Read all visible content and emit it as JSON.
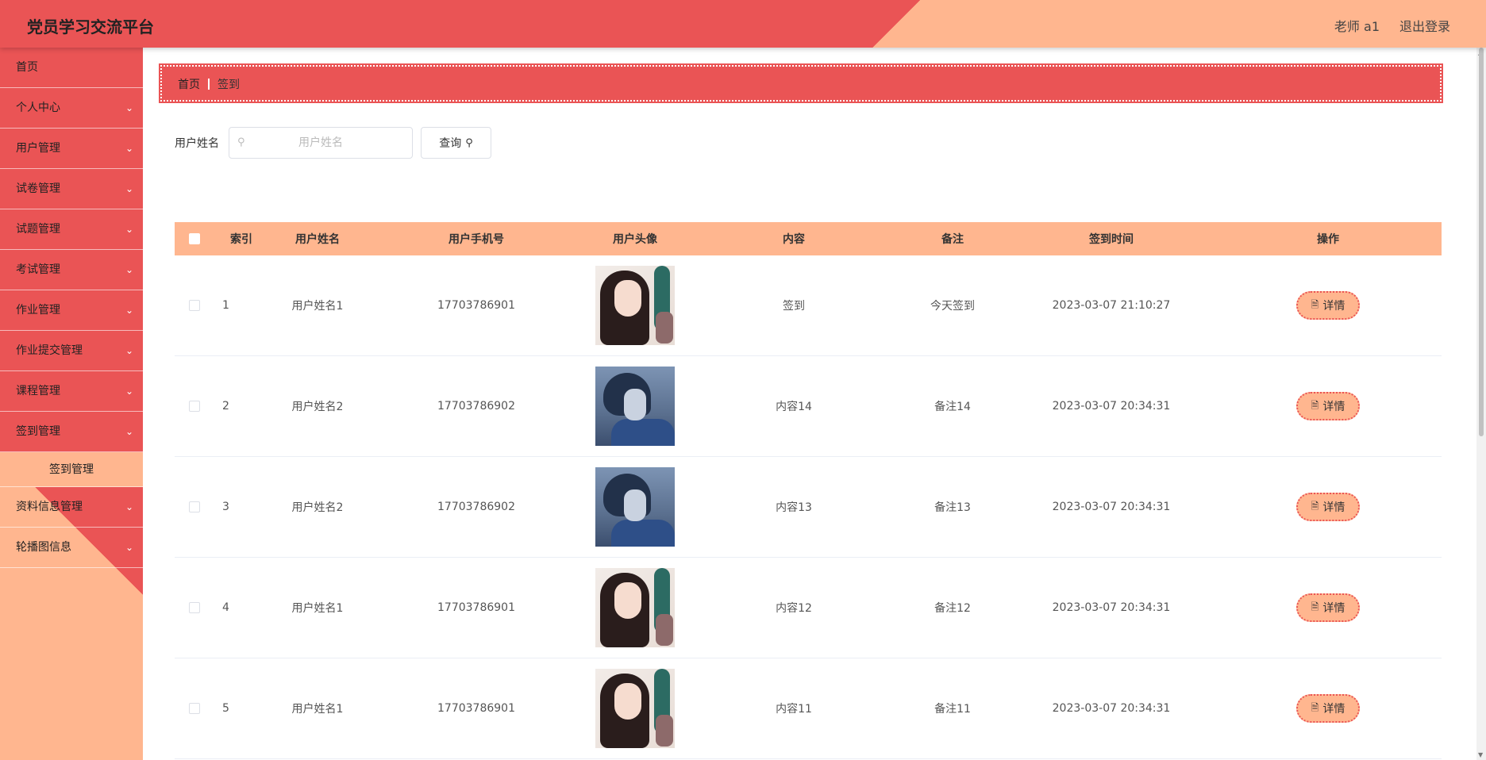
{
  "header": {
    "title": "党员学习交流平台",
    "user": "老师 a1",
    "logout": "退出登录"
  },
  "sidebar": {
    "items": [
      {
        "label": "首页",
        "expandable": false
      },
      {
        "label": "个人中心",
        "expandable": true
      },
      {
        "label": "用户管理",
        "expandable": true
      },
      {
        "label": "试卷管理",
        "expandable": true
      },
      {
        "label": "试题管理",
        "expandable": true
      },
      {
        "label": "考试管理",
        "expandable": true
      },
      {
        "label": "作业管理",
        "expandable": true
      },
      {
        "label": "作业提交管理",
        "expandable": true
      },
      {
        "label": "课程管理",
        "expandable": true
      },
      {
        "label": "签到管理",
        "expandable": true,
        "expanded": true
      },
      {
        "label": "资料信息管理",
        "expandable": true
      },
      {
        "label": "轮播图信息",
        "expandable": true
      }
    ],
    "submenu": {
      "label": "签到管理"
    }
  },
  "breadcrumb": {
    "home": "首页",
    "current": "签到"
  },
  "search": {
    "label": "用户姓名",
    "placeholder": "用户姓名",
    "value": "",
    "button": "查询"
  },
  "table": {
    "headers": [
      "索引",
      "用户姓名",
      "用户手机号",
      "用户头像",
      "内容",
      "备注",
      "签到时间",
      "操作"
    ],
    "rows": [
      {
        "index": "1",
        "name": "用户姓名1",
        "phone": "17703786901",
        "avatar": "girl",
        "content": "签到",
        "remark": "今天签到",
        "time": "2023-03-07 21:10:27",
        "op": "详情"
      },
      {
        "index": "2",
        "name": "用户姓名2",
        "phone": "17703786902",
        "avatar": "boy",
        "content": "内容14",
        "remark": "备注14",
        "time": "2023-03-07 20:34:31",
        "op": "详情"
      },
      {
        "index": "3",
        "name": "用户姓名2",
        "phone": "17703786902",
        "avatar": "boy",
        "content": "内容13",
        "remark": "备注13",
        "time": "2023-03-07 20:34:31",
        "op": "详情"
      },
      {
        "index": "4",
        "name": "用户姓名1",
        "phone": "17703786901",
        "avatar": "girl",
        "content": "内容12",
        "remark": "备注12",
        "time": "2023-03-07 20:34:31",
        "op": "详情"
      },
      {
        "index": "5",
        "name": "用户姓名1",
        "phone": "17703786901",
        "avatar": "girl",
        "content": "内容11",
        "remark": "备注11",
        "time": "2023-03-07 20:34:31",
        "op": "详情"
      }
    ]
  },
  "colors": {
    "primary": "#ea5455",
    "accent": "#ffb68f"
  }
}
